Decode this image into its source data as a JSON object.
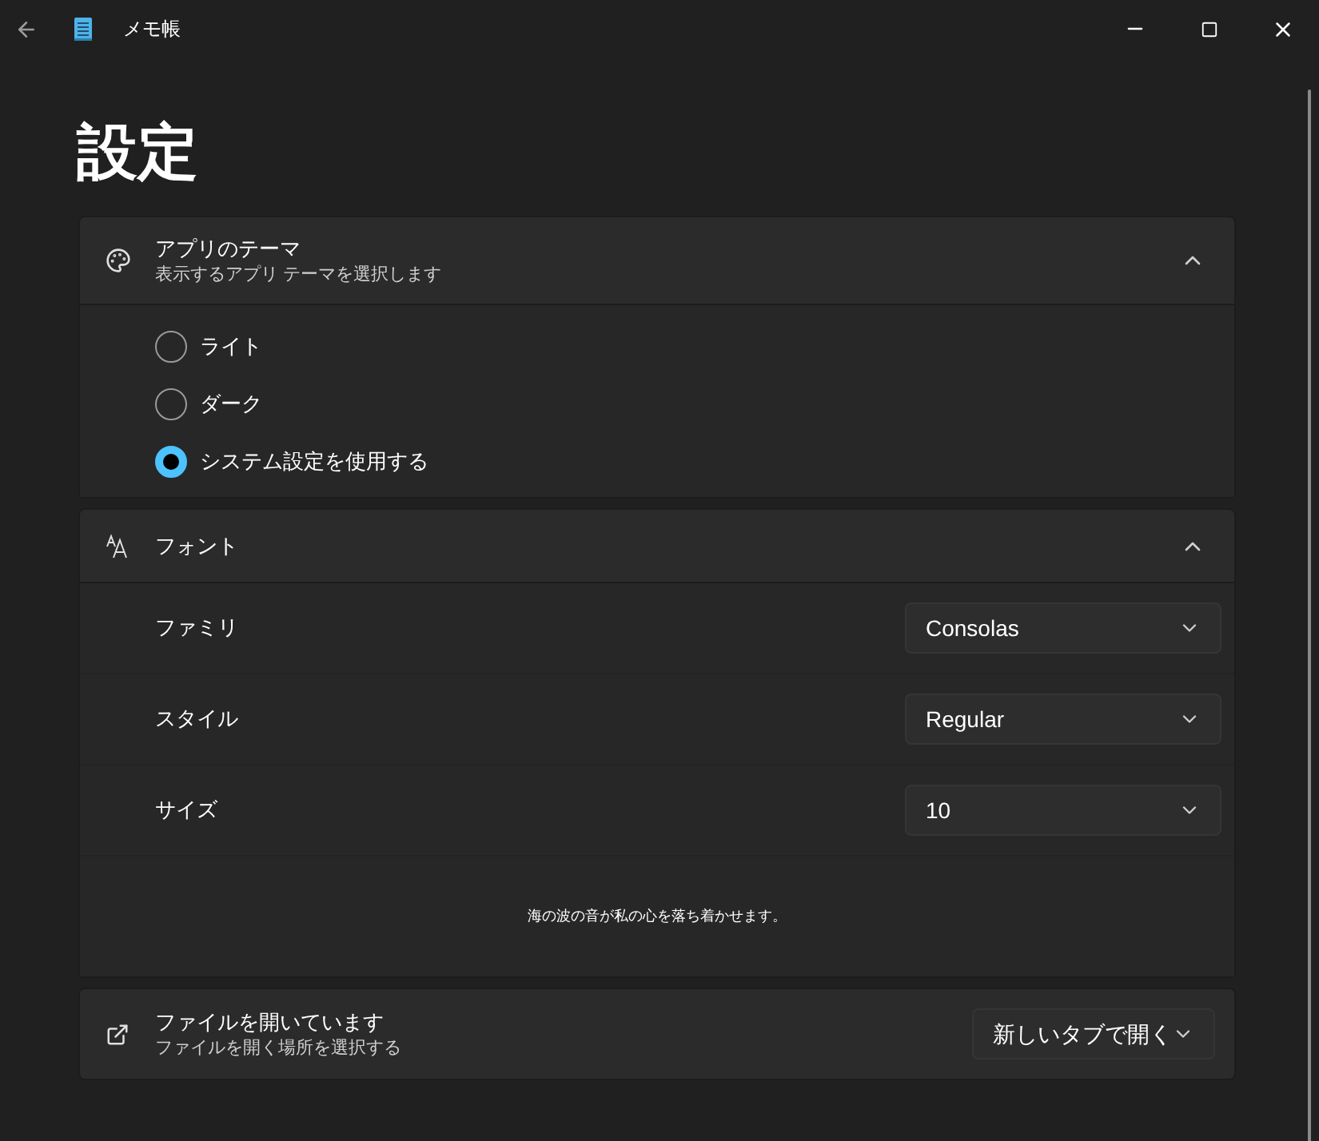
{
  "window": {
    "title": "メモ帳"
  },
  "page_title": "設定",
  "theme": {
    "title": "アプリのテーマ",
    "subtitle": "表示するアプリ テーマを選択します",
    "expanded": true,
    "options": [
      {
        "label": "ライト",
        "selected": false
      },
      {
        "label": "ダーク",
        "selected": false
      },
      {
        "label": "システム設定を使用する",
        "selected": true
      }
    ]
  },
  "font": {
    "title": "フォント",
    "expanded": true,
    "rows": [
      {
        "label": "ファミリ",
        "value": "Consolas"
      },
      {
        "label": "スタイル",
        "value": "Regular"
      },
      {
        "label": "サイズ",
        "value": "10"
      }
    ],
    "preview": "海の波の音が私の心を落ち着かせます。"
  },
  "file_open": {
    "title": "ファイルを開いています",
    "subtitle": "ファイルを開く場所を選択する",
    "value": "新しいタブで開く"
  }
}
